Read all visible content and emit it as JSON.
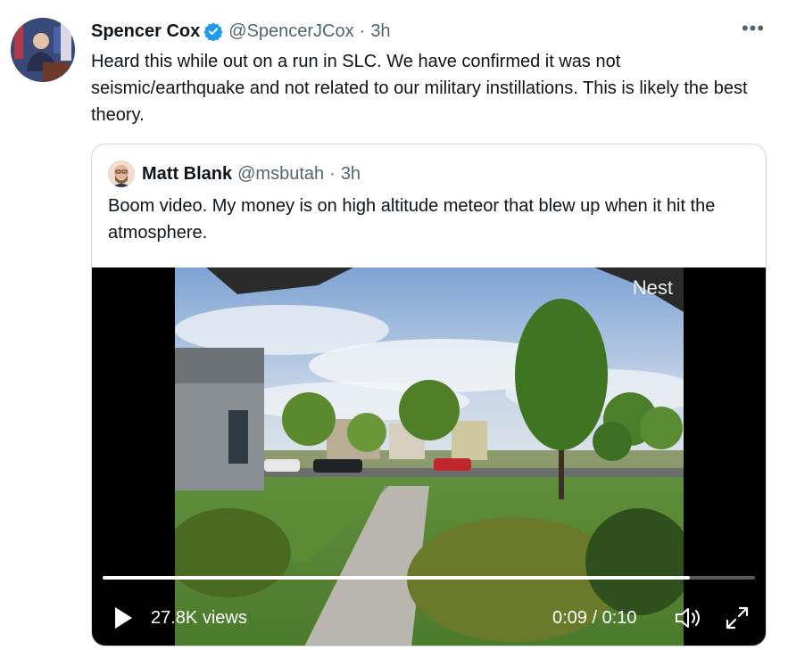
{
  "tweet": {
    "author_name": "Spencer Cox",
    "author_handle": "@SpencerJCox",
    "separator": "·",
    "time": "3h",
    "more_label": "•••",
    "text": "Heard this while out on a run in SLC. We have confirmed it was not seismic/earthquake and not related to our military instillations. This is likely the best theory."
  },
  "quoted_tweet": {
    "author_name": "Matt Blank",
    "author_handle": "@msbutah",
    "separator": "·",
    "time": "3h",
    "text": "Boom video. My money is on high altitude meteor that blew up when it hit the atmosphere."
  },
  "video": {
    "watermark": "Nest",
    "views": "27.8K views",
    "timecode": "0:09 / 0:10",
    "progress": 0.9
  },
  "colors": {
    "verified_blue": "#1d9bf0",
    "secondary_text": "#536471",
    "border": "#cfd9de"
  },
  "icons": {
    "verified": "verified-badge-icon",
    "more": "more-icon",
    "play": "play-icon",
    "volume": "volume-icon",
    "fullscreen": "fullscreen-icon"
  }
}
